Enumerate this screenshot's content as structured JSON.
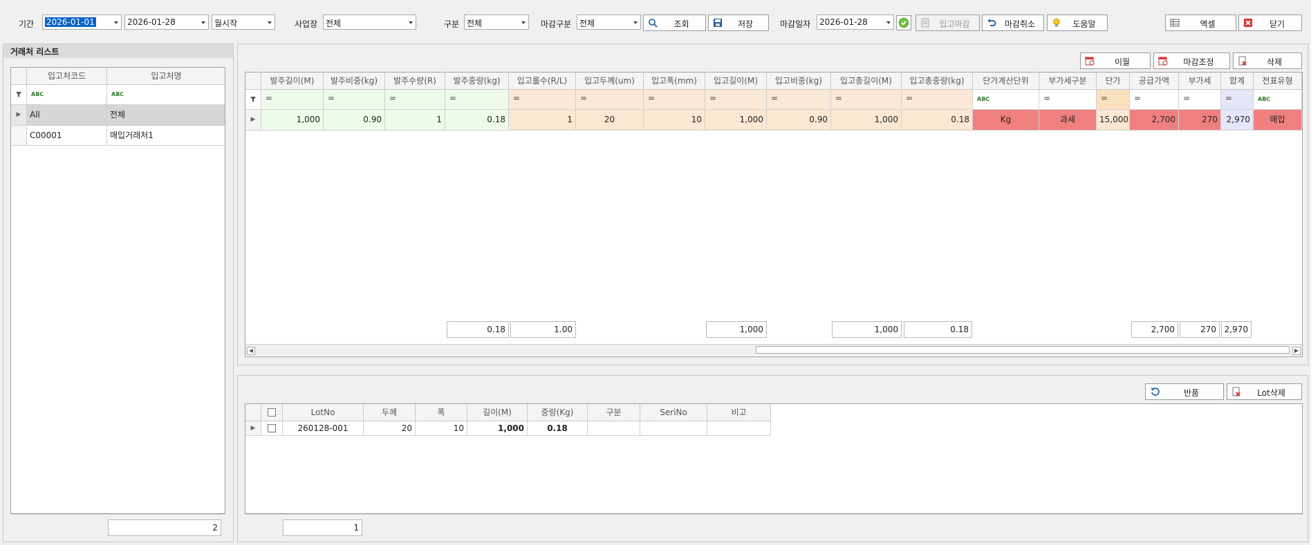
{
  "toolbar": {
    "period_label": "기간",
    "date_from": "2026-01-01",
    "date_to": "2026-01-28",
    "month_start": "월시작",
    "site_label": "사업장",
    "site_value": "전체",
    "type_label": "구분",
    "type_value": "전체",
    "close_type_label": "마감구분",
    "close_type_value": "전체",
    "search_btn": "조회",
    "save_btn": "저장",
    "close_date_label": "마감일자",
    "close_date_value": "2026-01-28",
    "receipt_close_btn": "입고마감",
    "cancel_close_btn": "마감취소",
    "help_btn": "도움말",
    "excel_btn": "엑셀",
    "exit_btn": "닫기"
  },
  "left": {
    "title": "거래처 리스트",
    "col_code": "입고처코드",
    "col_name": "입고처명",
    "filter_abc": "ABC",
    "rows": [
      {
        "code": "All",
        "name": "전체"
      },
      {
        "code": "C00001",
        "name": "매입거래처1"
      }
    ],
    "count": "2"
  },
  "upper": {
    "btn_transfer": "이월",
    "btn_adjust": "마감조정",
    "btn_delete": "삭제",
    "columns": [
      "발주길이(M)",
      "발주비중(kg)",
      "발주수량(R)",
      "발주중량(kg)",
      "입고롤수(R/L)",
      "입고두께(um)",
      "입고폭(mm)",
      "입고길이(M)",
      "입고비중(kg)",
      "입고총길이(M)",
      "입고총중량(kg)",
      "단가계산단위",
      "부가세구분",
      "단가",
      "공급가액",
      "부가세",
      "합계",
      "전표유형"
    ],
    "filter_eq": "=",
    "row": [
      "1,000",
      "0.90",
      "1",
      "0.18",
      "1",
      "20",
      "10",
      "1,000",
      "0.90",
      "1,000",
      "0.18",
      "Kg",
      "과세",
      "15,000",
      "2,700",
      "270",
      "2,970",
      "매입"
    ],
    "totals": {
      "order_weight": "0.18",
      "rolls": "1.00",
      "length": "1,000",
      "total_length": "1,000",
      "total_weight": "0.18",
      "supply": "2,700",
      "vat": "270",
      "sum": "2,970"
    }
  },
  "lower": {
    "btn_return": "반품",
    "btn_lot_delete": "Lot삭제",
    "columns": [
      "LotNo",
      "두께",
      "폭",
      "길이(M)",
      "중량(Kg)",
      "구분",
      "SeriNo",
      "비고"
    ],
    "row": [
      "260128-001",
      "20",
      "10",
      "1,000",
      "0.18",
      "",
      "",
      ""
    ],
    "count": "1"
  },
  "colors": {
    "green_cell": "#edfbe9",
    "peach_cell": "#fbe7d2",
    "red_cell": "#f08080",
    "blue_cell": "#e6e6fa"
  }
}
